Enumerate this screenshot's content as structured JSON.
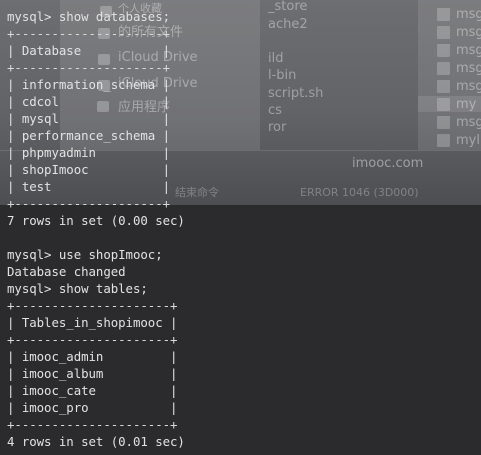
{
  "background": {
    "finder_left": [
      {
        "icon": "clock-icon",
        "label": "个人收藏"
      },
      {
        "icon": "cloud-icon",
        "label": "iCloud Drive"
      },
      {
        "icon": "document-icon",
        "label": "的所有文件"
      },
      {
        "icon": "cloud-icon",
        "label": "iCloud Drive"
      },
      {
        "icon": "apps-icon",
        "label": "应用程序"
      }
    ],
    "finder_middle": [
      "_store",
      "ache2",
      "ild",
      "l-bin",
      "script.sh",
      "cs",
      "ror"
    ],
    "finder_right": [
      "msg",
      "msg",
      "msg",
      "msg",
      "msg",
      "my",
      "msg",
      "myl"
    ],
    "watermark": "imooc.com",
    "status_left": "结束命令",
    "status_error": "ERROR 1046 (3D000)"
  },
  "terminal": {
    "lines": [
      "mysql> show databases;",
      "+--------------------+",
      "| Database           |",
      "+--------------------+",
      "| information_schema |",
      "| cdcol              |",
      "| mysql              |",
      "| performance_schema |",
      "| phpmyadmin         |",
      "| shopImooc          |",
      "| test               |",
      "+--------------------+",
      "7 rows in set (0.00 sec)",
      "",
      "mysql> use shopImooc;",
      "Database changed",
      "mysql> show tables;",
      "+---------------------+",
      "| Tables_in_shopimooc |",
      "+---------------------+",
      "| imooc_admin         |",
      "| imooc_album         |",
      "| imooc_cate          |",
      "| imooc_pro           |",
      "+---------------------+",
      "4 rows in set (0.01 sec)"
    ]
  }
}
